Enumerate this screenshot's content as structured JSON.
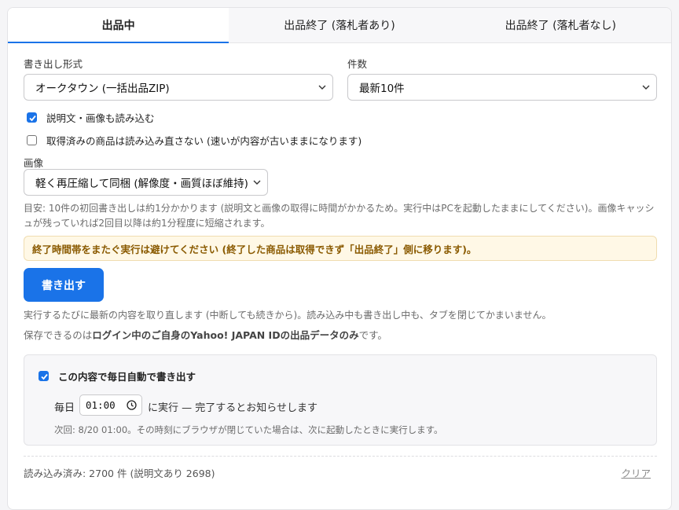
{
  "tabs": [
    {
      "label": "出品中",
      "active": true
    },
    {
      "label": "出品終了 (落札者あり)",
      "active": false
    },
    {
      "label": "出品終了 (落札者なし)",
      "active": false
    }
  ],
  "format": {
    "label": "書き出し形式",
    "value": "オークタウン (一括出品ZIP)"
  },
  "count": {
    "label": "件数",
    "value": "最新10件"
  },
  "options": {
    "include_desc": {
      "label": "説明文・画像も読み込む",
      "checked": true
    },
    "skip_loaded": {
      "label": "取得済みの商品は読み込み直さない (速いが内容が古いままになります)",
      "checked": false
    }
  },
  "image": {
    "label": "画像",
    "value": "軽く再圧縮して同梱 (解像度・画質ほぼ維持)"
  },
  "estimate_note": "目安: 10件の初回書き出しは約1分かかります (説明文と画像の取得に時間がかかるため。実行中はPCを起動したままにしてください)。画像キャッシュが残っていれば2回目以降は約1分程度に短縮されます。",
  "warning": "終了時間帯をまたぐ実行は避けてください (終了した商品は取得できず「出品終了」側に移ります)。",
  "export_button": "書き出す",
  "refresh_note": "実行するたびに最新の内容を取り直します (中断しても続きから)。読み込み中も書き出し中も、タブを閉じてかまいません。",
  "save_note": {
    "prefix": "保存できるのは",
    "bold": "ログイン中のご自身のYahoo! JAPAN IDの出品データのみ",
    "suffix": "です。"
  },
  "schedule": {
    "enabled_label": "この内容で毎日自動で書き出す",
    "enabled": true,
    "daily_label": "毎日",
    "time": "01:00",
    "after_time": "に実行 — 完了するとお知らせします",
    "next_run": "次回: 8/20 01:00。その時刻にブラウザが閉じていた場合は、次に起動したときに実行します。"
  },
  "loaded_summary": "読み込み済み: 2700 件 (説明文あり 2698)",
  "clear_label": "クリア",
  "colors": {
    "accent": "#1a73e8",
    "warning_bg": "#fff8e6",
    "warning_text": "#8a5a00"
  }
}
